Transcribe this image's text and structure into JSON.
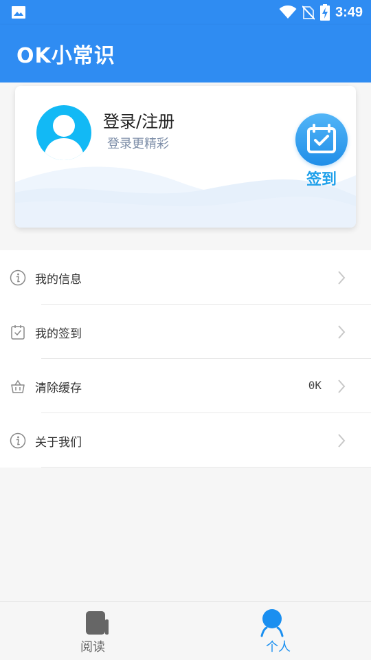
{
  "status_bar": {
    "time": "3:49"
  },
  "app_bar": {
    "title": "OK小常识"
  },
  "profile": {
    "login_title": "登录/注册",
    "login_subtitle": "登录更精彩",
    "sign_in_label": "签到"
  },
  "menu": {
    "items": [
      {
        "label": "我的信息",
        "icon": "info-icon",
        "value": ""
      },
      {
        "label": "我的签到",
        "icon": "calendar-check-icon",
        "value": ""
      },
      {
        "label": "清除缓存",
        "icon": "basket-icon",
        "value": "0K"
      },
      {
        "label": "关于我们",
        "icon": "info-icon",
        "value": ""
      }
    ]
  },
  "bottom_nav": {
    "tabs": [
      {
        "label": "阅读",
        "icon": "book-icon",
        "active": false
      },
      {
        "label": "个人",
        "icon": "person-icon",
        "active": true
      }
    ]
  },
  "colors": {
    "primary": "#2f8cf2",
    "avatar_bg": "#12b9f5",
    "accent_text": "#1fa0ea",
    "active_tab": "#1a8ff0"
  }
}
